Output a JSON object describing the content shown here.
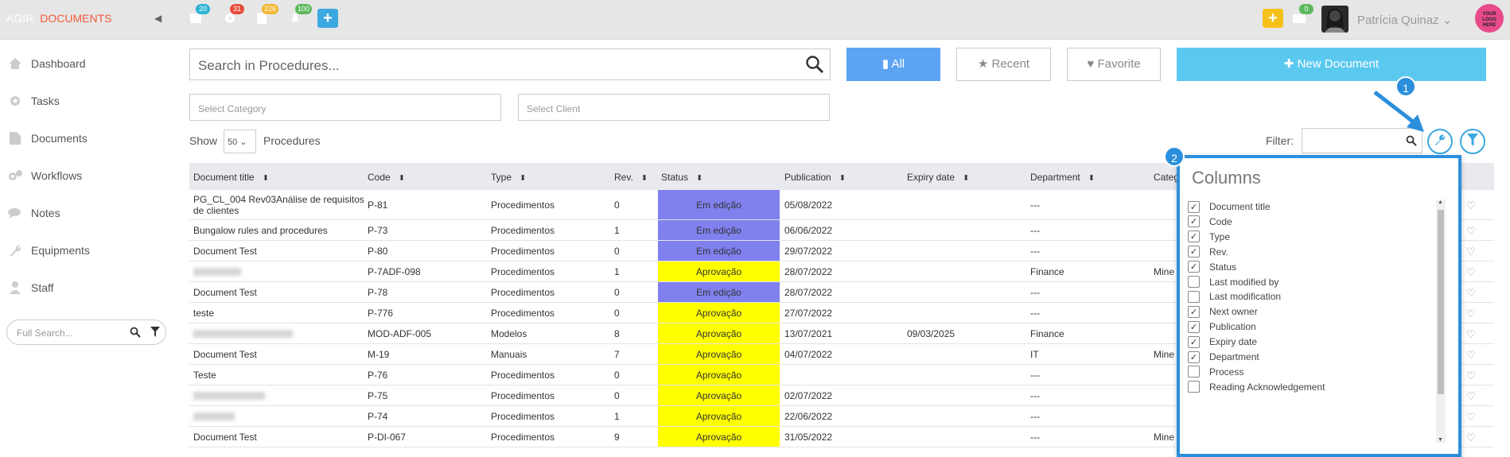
{
  "brand": {
    "part1": "AGIR",
    "part2": "DOCUMENTS"
  },
  "topbar": {
    "badges": [
      {
        "icon": "calendar-icon",
        "count": "20",
        "color": "#2ab3d3"
      },
      {
        "icon": "gear-icon",
        "count": "31",
        "color": "#e84c3d"
      },
      {
        "icon": "clipboard-icon",
        "count": "226",
        "color": "#f2b632"
      },
      {
        "icon": "bell-icon",
        "count": "100",
        "color": "#5cb85c"
      }
    ],
    "mail_count": "0",
    "user_name": "Patrícia Quinaz",
    "logo_text": "YOUR LOGO HERE",
    "accent_blue": "#3ba8e0",
    "accent_yellow": "#f6c01a"
  },
  "sidebar": {
    "items": [
      {
        "label": "Dashboard",
        "icon": "home-icon"
      },
      {
        "label": "Tasks",
        "icon": "gear-icon"
      },
      {
        "label": "Documents",
        "icon": "document-icon"
      },
      {
        "label": "Workflows",
        "icon": "gears-icon"
      },
      {
        "label": "Notes",
        "icon": "chat-icon"
      },
      {
        "label": "Equipments",
        "icon": "wrench-icon"
      },
      {
        "label": "Staff",
        "icon": "user-icon"
      }
    ],
    "search_placeholder": "Full Search..."
  },
  "toolbar": {
    "search_placeholder": "Search in Procedures...",
    "all_label": "All",
    "recent_label": "Recent",
    "favorite_label": "Favorite",
    "new_document_label": "New Document",
    "category_placeholder": "Select Category",
    "client_placeholder": "Select Client",
    "show_label": "Show",
    "page_size": "50",
    "procedures_label": "Procedures",
    "filter_label": "Filter:"
  },
  "table": {
    "headers": [
      "Document title",
      "Code",
      "Type",
      "Rev.",
      "Status",
      "Publication",
      "Expiry date",
      "Department",
      "Categ"
    ],
    "rows": [
      {
        "title": "PG_CL_004 Rev03Análise de requisitos de clientes",
        "code": "P-81",
        "type": "Procedimentos",
        "rev": "0",
        "status": "Em edição",
        "status_color": "#8080ee",
        "publication": "05/08/2022",
        "expiry": "",
        "department": "---",
        "category": ""
      },
      {
        "title": "Bungalow rules and procedures",
        "code": "P-73",
        "type": "Procedimentos",
        "rev": "1",
        "status": "Em edição",
        "status_color": "#8080ee",
        "publication": "06/06/2022",
        "expiry": "",
        "department": "---",
        "category": ""
      },
      {
        "title": "Document Test",
        "code": "P-80",
        "type": "Procedimentos",
        "rev": "0",
        "status": "Em edição",
        "status_color": "#8080ee",
        "publication": "29/07/2022",
        "expiry": "",
        "department": "---",
        "category": ""
      },
      {
        "title": "",
        "code": "P-7ADF-098",
        "type": "Procedimentos",
        "rev": "1",
        "status": "Aprovação",
        "status_color": "#ffff00",
        "publication": "28/07/2022",
        "expiry": "",
        "department": "Finance",
        "category": "Mine"
      },
      {
        "title": "Document Test",
        "code": "P-78",
        "type": "Procedimentos",
        "rev": "0",
        "status": "Em edição",
        "status_color": "#8080ee",
        "publication": "28/07/2022",
        "expiry": "",
        "department": "---",
        "category": ""
      },
      {
        "title": "teste",
        "code": "P-776",
        "type": "Procedimentos",
        "rev": "0",
        "status": "Aprovação",
        "status_color": "#ffff00",
        "publication": "27/07/2022",
        "expiry": "",
        "department": "---",
        "category": ""
      },
      {
        "title": "",
        "code": "MOD-ADF-005",
        "type": "Modelos",
        "rev": "8",
        "status": "Aprovação",
        "status_color": "#ffff00",
        "publication": "13/07/2021",
        "expiry": "09/03/2025",
        "department": "Finance",
        "category": ""
      },
      {
        "title": "Document Test",
        "code": "M-19",
        "type": "Manuais",
        "rev": "7",
        "status": "Aprovação",
        "status_color": "#ffff00",
        "publication": "04/07/2022",
        "expiry": "",
        "department": "IT",
        "category": "Mine"
      },
      {
        "title": "Teste",
        "code": "P-76",
        "type": "Procedimentos",
        "rev": "0",
        "status": "Aprovação",
        "status_color": "#ffff00",
        "publication": "",
        "expiry": "",
        "department": "---",
        "category": ""
      },
      {
        "title": "",
        "code": "P-75",
        "type": "Procedimentos",
        "rev": "0",
        "status": "Aprovação",
        "status_color": "#ffff00",
        "publication": "02/07/2022",
        "expiry": "",
        "department": "---",
        "category": ""
      },
      {
        "title": "",
        "code": "P-74",
        "type": "Procedimentos",
        "rev": "1",
        "status": "Aprovação",
        "status_color": "#ffff00",
        "publication": "22/06/2022",
        "expiry": "",
        "department": "---",
        "category": ""
      },
      {
        "title": "Document Test",
        "code": "P-DI-067",
        "type": "Procedimentos",
        "rev": "9",
        "status": "Aprovação",
        "status_color": "#ffff00",
        "publication": "31/05/2022",
        "expiry": "",
        "department": "---",
        "category": "Mine"
      }
    ]
  },
  "columns_popover": {
    "title": "Columns",
    "items": [
      {
        "label": "Document title",
        "checked": true
      },
      {
        "label": "Code",
        "checked": true
      },
      {
        "label": "Type",
        "checked": true
      },
      {
        "label": "Rev.",
        "checked": true
      },
      {
        "label": "Status",
        "checked": true
      },
      {
        "label": "Last modified by",
        "checked": false
      },
      {
        "label": "Last modification",
        "checked": false
      },
      {
        "label": "Next owner",
        "checked": true
      },
      {
        "label": "Publication",
        "checked": true
      },
      {
        "label": "Expiry date",
        "checked": true
      },
      {
        "label": "Department",
        "checked": true
      },
      {
        "label": "Process",
        "checked": false
      },
      {
        "label": "Reading Acknowledgement",
        "checked": false
      }
    ]
  },
  "annotations": {
    "step1": "1",
    "step2": "2"
  }
}
